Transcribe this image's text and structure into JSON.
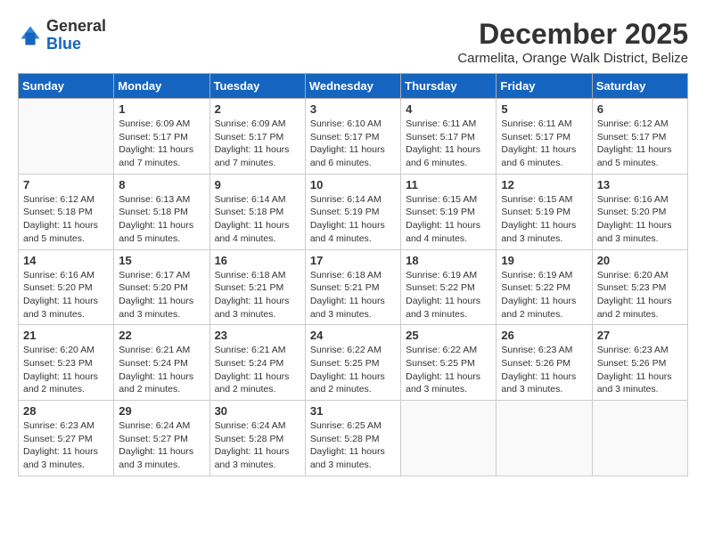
{
  "logo": {
    "general": "General",
    "blue": "Blue"
  },
  "header": {
    "month": "December 2025",
    "location": "Carmelita, Orange Walk District, Belize"
  },
  "weekdays": [
    "Sunday",
    "Monday",
    "Tuesday",
    "Wednesday",
    "Thursday",
    "Friday",
    "Saturday"
  ],
  "weeks": [
    [
      {
        "date": "",
        "info": ""
      },
      {
        "date": "1",
        "info": "Sunrise: 6:09 AM\nSunset: 5:17 PM\nDaylight: 11 hours\nand 7 minutes."
      },
      {
        "date": "2",
        "info": "Sunrise: 6:09 AM\nSunset: 5:17 PM\nDaylight: 11 hours\nand 7 minutes."
      },
      {
        "date": "3",
        "info": "Sunrise: 6:10 AM\nSunset: 5:17 PM\nDaylight: 11 hours\nand 6 minutes."
      },
      {
        "date": "4",
        "info": "Sunrise: 6:11 AM\nSunset: 5:17 PM\nDaylight: 11 hours\nand 6 minutes."
      },
      {
        "date": "5",
        "info": "Sunrise: 6:11 AM\nSunset: 5:17 PM\nDaylight: 11 hours\nand 6 minutes."
      },
      {
        "date": "6",
        "info": "Sunrise: 6:12 AM\nSunset: 5:17 PM\nDaylight: 11 hours\nand 5 minutes."
      }
    ],
    [
      {
        "date": "7",
        "info": "Sunrise: 6:12 AM\nSunset: 5:18 PM\nDaylight: 11 hours\nand 5 minutes."
      },
      {
        "date": "8",
        "info": "Sunrise: 6:13 AM\nSunset: 5:18 PM\nDaylight: 11 hours\nand 5 minutes."
      },
      {
        "date": "9",
        "info": "Sunrise: 6:14 AM\nSunset: 5:18 PM\nDaylight: 11 hours\nand 4 minutes."
      },
      {
        "date": "10",
        "info": "Sunrise: 6:14 AM\nSunset: 5:19 PM\nDaylight: 11 hours\nand 4 minutes."
      },
      {
        "date": "11",
        "info": "Sunrise: 6:15 AM\nSunset: 5:19 PM\nDaylight: 11 hours\nand 4 minutes."
      },
      {
        "date": "12",
        "info": "Sunrise: 6:15 AM\nSunset: 5:19 PM\nDaylight: 11 hours\nand 3 minutes."
      },
      {
        "date": "13",
        "info": "Sunrise: 6:16 AM\nSunset: 5:20 PM\nDaylight: 11 hours\nand 3 minutes."
      }
    ],
    [
      {
        "date": "14",
        "info": "Sunrise: 6:16 AM\nSunset: 5:20 PM\nDaylight: 11 hours\nand 3 minutes."
      },
      {
        "date": "15",
        "info": "Sunrise: 6:17 AM\nSunset: 5:20 PM\nDaylight: 11 hours\nand 3 minutes."
      },
      {
        "date": "16",
        "info": "Sunrise: 6:18 AM\nSunset: 5:21 PM\nDaylight: 11 hours\nand 3 minutes."
      },
      {
        "date": "17",
        "info": "Sunrise: 6:18 AM\nSunset: 5:21 PM\nDaylight: 11 hours\nand 3 minutes."
      },
      {
        "date": "18",
        "info": "Sunrise: 6:19 AM\nSunset: 5:22 PM\nDaylight: 11 hours\nand 3 minutes."
      },
      {
        "date": "19",
        "info": "Sunrise: 6:19 AM\nSunset: 5:22 PM\nDaylight: 11 hours\nand 2 minutes."
      },
      {
        "date": "20",
        "info": "Sunrise: 6:20 AM\nSunset: 5:23 PM\nDaylight: 11 hours\nand 2 minutes."
      }
    ],
    [
      {
        "date": "21",
        "info": "Sunrise: 6:20 AM\nSunset: 5:23 PM\nDaylight: 11 hours\nand 2 minutes."
      },
      {
        "date": "22",
        "info": "Sunrise: 6:21 AM\nSunset: 5:24 PM\nDaylight: 11 hours\nand 2 minutes."
      },
      {
        "date": "23",
        "info": "Sunrise: 6:21 AM\nSunset: 5:24 PM\nDaylight: 11 hours\nand 2 minutes."
      },
      {
        "date": "24",
        "info": "Sunrise: 6:22 AM\nSunset: 5:25 PM\nDaylight: 11 hours\nand 2 minutes."
      },
      {
        "date": "25",
        "info": "Sunrise: 6:22 AM\nSunset: 5:25 PM\nDaylight: 11 hours\nand 3 minutes."
      },
      {
        "date": "26",
        "info": "Sunrise: 6:23 AM\nSunset: 5:26 PM\nDaylight: 11 hours\nand 3 minutes."
      },
      {
        "date": "27",
        "info": "Sunrise: 6:23 AM\nSunset: 5:26 PM\nDaylight: 11 hours\nand 3 minutes."
      }
    ],
    [
      {
        "date": "28",
        "info": "Sunrise: 6:23 AM\nSunset: 5:27 PM\nDaylight: 11 hours\nand 3 minutes."
      },
      {
        "date": "29",
        "info": "Sunrise: 6:24 AM\nSunset: 5:27 PM\nDaylight: 11 hours\nand 3 minutes."
      },
      {
        "date": "30",
        "info": "Sunrise: 6:24 AM\nSunset: 5:28 PM\nDaylight: 11 hours\nand 3 minutes."
      },
      {
        "date": "31",
        "info": "Sunrise: 6:25 AM\nSunset: 5:28 PM\nDaylight: 11 hours\nand 3 minutes."
      },
      {
        "date": "",
        "info": ""
      },
      {
        "date": "",
        "info": ""
      },
      {
        "date": "",
        "info": ""
      }
    ]
  ]
}
